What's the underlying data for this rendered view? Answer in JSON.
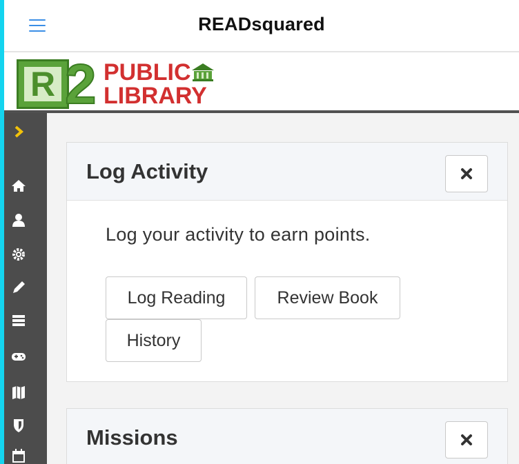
{
  "header": {
    "title": "READsquared",
    "menu_icon": "hamburger-menu-icon"
  },
  "logo": {
    "r_letter": "R",
    "two": "2",
    "public": "PUBLIC",
    "library": "LIBRARY",
    "colors": {
      "green": "#5aa23a",
      "red": "#d23030"
    }
  },
  "sidebar": {
    "items": [
      {
        "icon": "chevron-right-icon",
        "color": "#f2c20a"
      },
      {
        "icon": "home-icon"
      },
      {
        "icon": "user-icon"
      },
      {
        "icon": "gear-icon"
      },
      {
        "icon": "pencil-icon"
      },
      {
        "icon": "list-icon"
      },
      {
        "icon": "gamepad-icon"
      },
      {
        "icon": "map-icon"
      },
      {
        "icon": "shield-icon"
      },
      {
        "icon": "calendar-icon"
      }
    ]
  },
  "log_activity": {
    "title": "Log Activity",
    "description": "Log your activity to earn points.",
    "buttons": {
      "log_reading": "Log Reading",
      "review_book": "Review Book",
      "history": "History"
    },
    "close_icon": "close-icon"
  },
  "missions": {
    "title": "Missions",
    "close_icon": "close-icon"
  }
}
